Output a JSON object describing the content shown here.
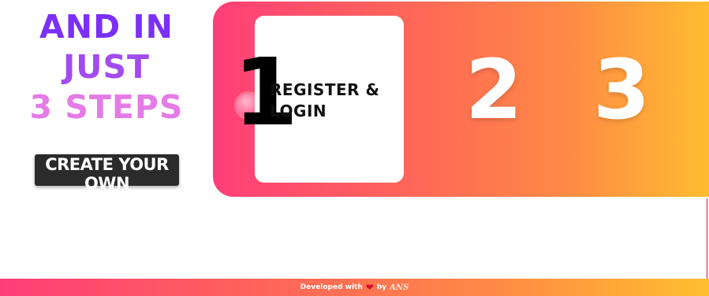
{
  "hero": {
    "line1": "AND IN",
    "line2": "JUST",
    "line3": "3 STEPS",
    "cta_label": "CREATE YOUR OWN"
  },
  "steps": [
    {
      "number": "1",
      "title": "REGISTER & LOGIN"
    },
    {
      "number": "2"
    },
    {
      "number": "3"
    }
  ],
  "footer": {
    "prefix": "Developed with",
    "heart_icon": "heart-icon",
    "by": "by",
    "signature": "ANS"
  },
  "colors": {
    "gradient_start": "#ff3e79",
    "gradient_end": "#ffbf2e",
    "heading_purple": "#7b2ff7",
    "heading_pink": "#e47be6",
    "button_bg": "#2b2b2b"
  }
}
